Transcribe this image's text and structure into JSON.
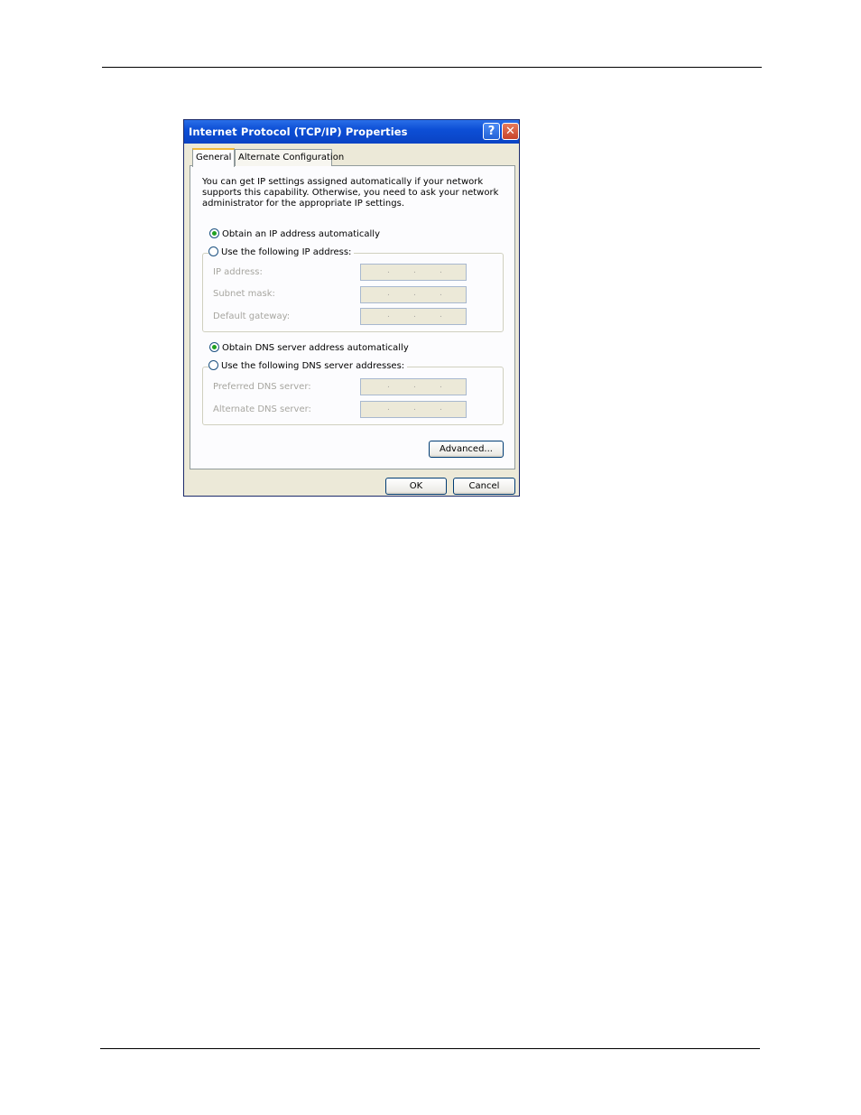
{
  "dialog": {
    "title": "Internet Protocol (TCP/IP) Properties",
    "help_label": "?",
    "close_label": "✕",
    "tabs": [
      {
        "label": "General"
      },
      {
        "label": "Alternate Configuration"
      }
    ],
    "intro_text": "You can get IP settings assigned automatically if your network supports this capability. Otherwise, you need to ask your network administrator for the appropriate IP settings.",
    "ip_options": {
      "auto": {
        "label": "Obtain an IP address automatically",
        "selected": true
      },
      "manual": {
        "label": "Use the following IP address:",
        "selected": false
      }
    },
    "ip_fields": [
      {
        "label": "IP address:",
        "value": ""
      },
      {
        "label": "Subnet mask:",
        "value": ""
      },
      {
        "label": "Default gateway:",
        "value": ""
      }
    ],
    "dns_options": {
      "auto": {
        "label": "Obtain DNS server address automatically",
        "selected": true
      },
      "manual": {
        "label": "Use the following DNS server addresses:",
        "selected": false
      }
    },
    "dns_fields": [
      {
        "label": "Preferred DNS server:",
        "value": ""
      },
      {
        "label": "Alternate DNS server:",
        "value": ""
      }
    ],
    "advanced_label": "Advanced...",
    "ok_label": "OK",
    "cancel_label": "Cancel"
  }
}
